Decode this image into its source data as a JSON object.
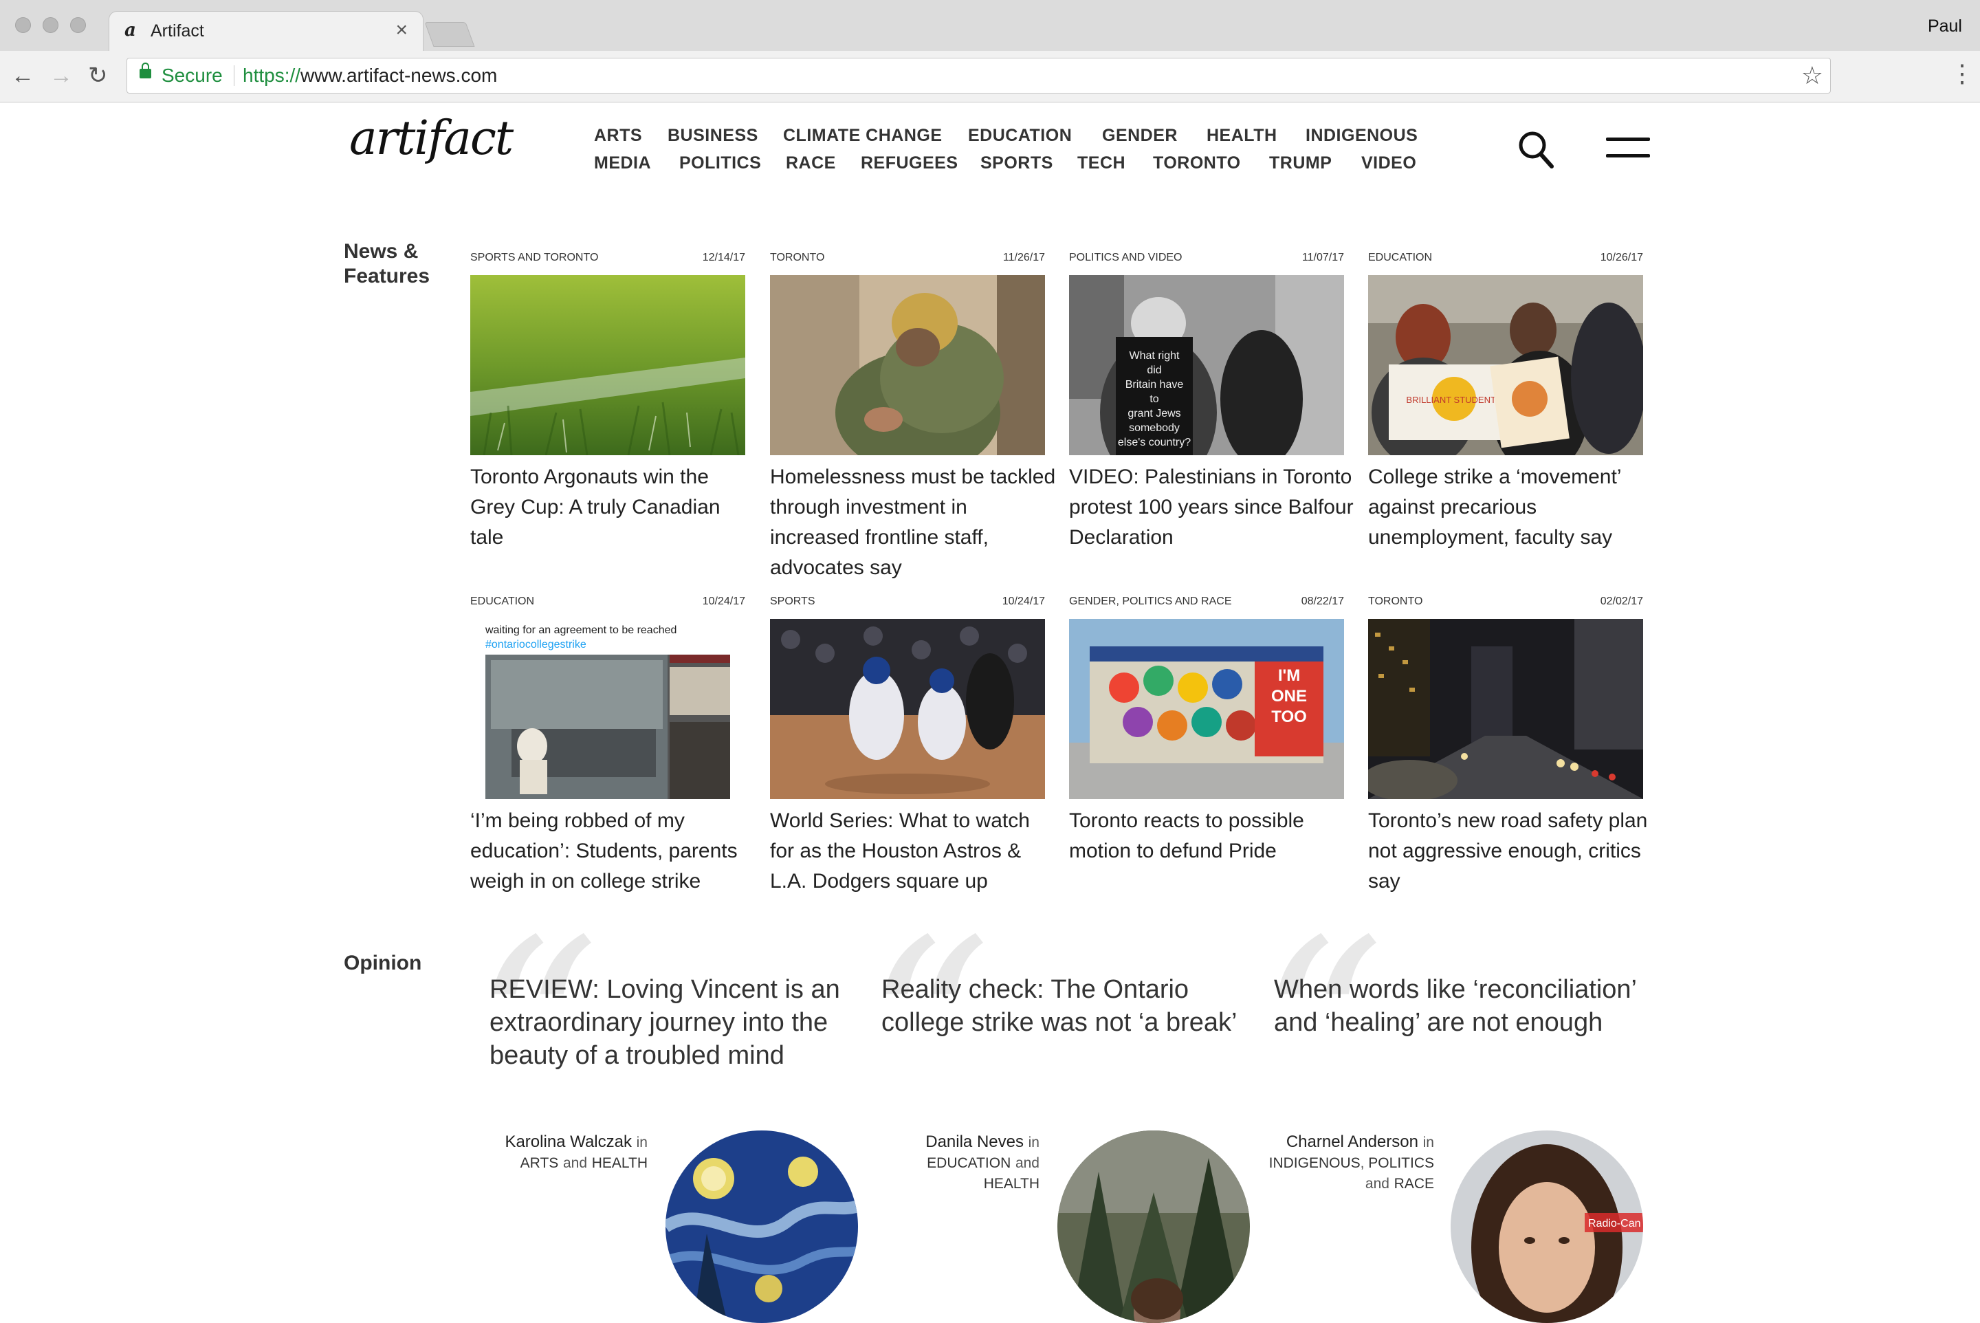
{
  "browser": {
    "tab_title": "Artifact",
    "tab_favicon": "a",
    "tab_close": "×",
    "profile": "Paul",
    "secure_label": "Secure",
    "url_protocol": "https://",
    "url_rest": "www.artifact-news.com",
    "back_icon": "←",
    "forward_icon": "→",
    "reload_icon": "↻",
    "star_icon": "☆",
    "menu_icon": "⋮"
  },
  "site": {
    "logo": "artifact",
    "nav_row1": [
      "ARTS",
      "BUSINESS",
      "CLIMATE CHANGE",
      "EDUCATION",
      "GENDER",
      "HEALTH",
      "INDIGENOUS"
    ],
    "nav_row2": [
      "MEDIA",
      "POLITICS",
      "RACE",
      "REFUGEES",
      "SPORTS",
      "TECH",
      "TORONTO",
      "TRUMP",
      "VIDEO"
    ]
  },
  "news": {
    "section_title_line1": "News &",
    "section_title_line2": "Features",
    "articles": [
      {
        "tags": "SPORTS and TORONTO",
        "date": "12/14/17",
        "headline": "Toronto Argonauts win the Grey Cup: A truly Canadian tale",
        "image": "grass"
      },
      {
        "tags": "TORONTO",
        "date": "11/26/17",
        "headline": "Homelessness must be tackled through investment in increased frontline staff, advocates say",
        "image": "homeless-man"
      },
      {
        "tags": "POLITICS and VIDEO",
        "date": "11/07/17",
        "headline": "VIDEO: Palestinians in Toronto protest 100 years since Balfour Declaration",
        "image": "protest-bw"
      },
      {
        "tags": "EDUCATION",
        "date": "10/26/17",
        "headline": "College strike a ‘movement’ against precarious unemployment, faculty say",
        "image": "strike-rally"
      },
      {
        "tags": "EDUCATION",
        "date": "10/24/17",
        "headline": "‘I’m being robbed of my education’: Students, parents weigh in on college strike",
        "image": "tweet-skeleton"
      },
      {
        "tags": "SPORTS",
        "date": "10/24/17",
        "headline": "World Series: What to watch for as the Houston Astros & L.A. Dodgers square up",
        "image": "baseball"
      },
      {
        "tags": "GENDER, POLITICS and RACE",
        "date": "08/22/17",
        "headline": "Toronto reacts to possible motion to defund Pride",
        "image": "mural"
      },
      {
        "tags": "TORONTO",
        "date": "02/02/17",
        "headline": "Toronto’s new road safety plan not aggressive enough, critics say",
        "image": "night-street"
      }
    ],
    "tweet_text": "waiting for an agreement to be reached",
    "tweet_hashtag": "#ontariocollegestrike",
    "protest_sign": [
      "What right",
      "did",
      "Britain have",
      "to",
      "grant Jews",
      "somebody",
      "else's country?"
    ],
    "mural_text": [
      "I'M",
      "ONE",
      "TOO"
    ],
    "strike_sign": "BRILLIANT STUDENTS"
  },
  "opinion": {
    "section_title": "Opinion",
    "quote_glyph": "“",
    "pieces": [
      {
        "title": "REVIEW: Loving Vincent is an extraordinary journey into the beauty of a troubled mind",
        "author": "Karolina Walczak",
        "in": "in",
        "cats": [
          "ARTS",
          "HEALTH"
        ],
        "and": "and",
        "avatar": "starry-night"
      },
      {
        "title": "Reality check: The Ontario college strike was not ‘a break’",
        "author": "Danila Neves",
        "in": "in",
        "cats": [
          "EDUCATION",
          "HEALTH"
        ],
        "and": "and",
        "avatar": "forest-portrait"
      },
      {
        "title": "When words like ‘reconciliation’ and ‘healing’ are not enough",
        "author": "Charnel Anderson",
        "in": "in",
        "cats": [
          "INDIGENOUS",
          "POLITICS",
          "RACE"
        ],
        "and": "and",
        "avatar": "studio-portrait"
      }
    ],
    "avatar3_text": "Radio-Can"
  }
}
